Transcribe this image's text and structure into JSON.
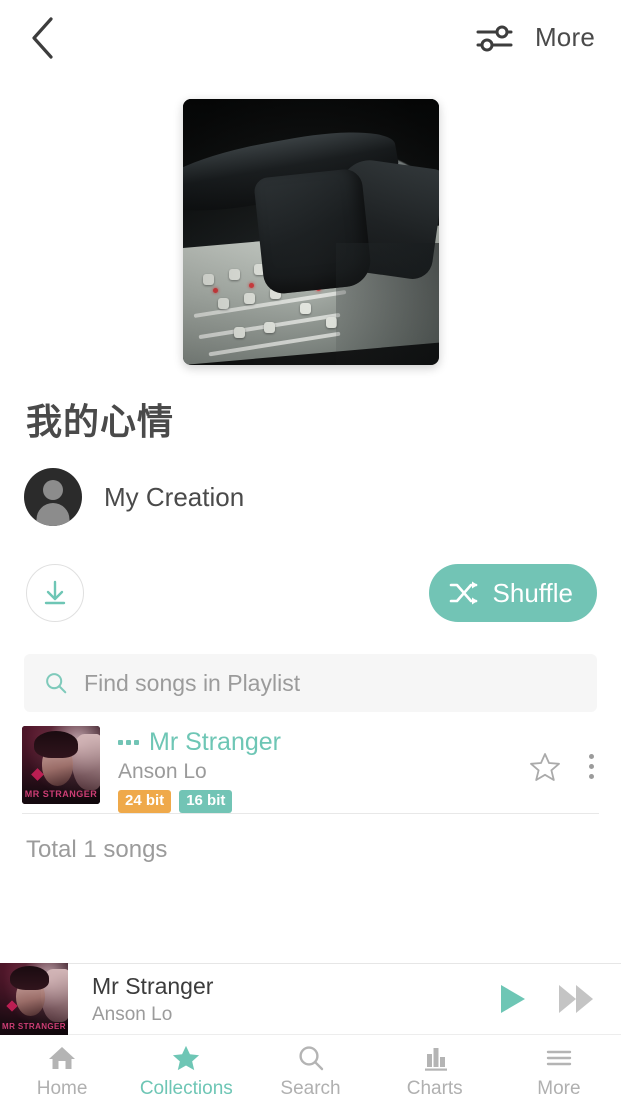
{
  "header": {
    "back_icon": "chevron-left-icon",
    "settings_icon": "sliders-icon",
    "more_label": "More"
  },
  "cover": {
    "alt": "headphones-on-mixing-console"
  },
  "playlist": {
    "title": "我的心情",
    "owner_name": "My Creation",
    "avatar_icon": "person-icon",
    "download_icon": "download-icon",
    "shuffle_label": "Shuffle",
    "shuffle_icon": "shuffle-icon",
    "total_label": "Total 1 songs"
  },
  "search": {
    "icon": "search-icon",
    "placeholder": "Find songs in Playlist",
    "value": ""
  },
  "songs": [
    {
      "title": "Mr Stranger",
      "artist": "Anson Lo",
      "playing_icon": "equalizer-dots-icon",
      "badges": [
        {
          "label": "24 bit",
          "color": "#efa94a"
        },
        {
          "label": "16 bit",
          "color": "#72c4b5"
        }
      ],
      "favorite_icon": "star-outline-icon",
      "menu_icon": "kebab-menu-icon",
      "artwork_wordmark": "MR STRANGER"
    }
  ],
  "now_playing": {
    "title": "Mr Stranger",
    "artist": "Anson Lo",
    "play_icon": "play-icon",
    "next_icon": "fast-forward-icon",
    "artwork_wordmark": "MR STRANGER"
  },
  "tabbar": {
    "items": [
      {
        "label": "Home",
        "icon": "home-icon",
        "active": false
      },
      {
        "label": "Collections",
        "icon": "star-icon",
        "active": true
      },
      {
        "label": "Search",
        "icon": "search-icon",
        "active": false
      },
      {
        "label": "Charts",
        "icon": "bar-chart-icon",
        "active": false
      },
      {
        "label": "More",
        "icon": "hamburger-icon",
        "active": false
      }
    ]
  },
  "colors": {
    "accent_teal": "#6ec6b5",
    "badge_orange": "#efa94a",
    "text_dark": "#4a4a4a",
    "text_muted": "#9b9b9b"
  }
}
